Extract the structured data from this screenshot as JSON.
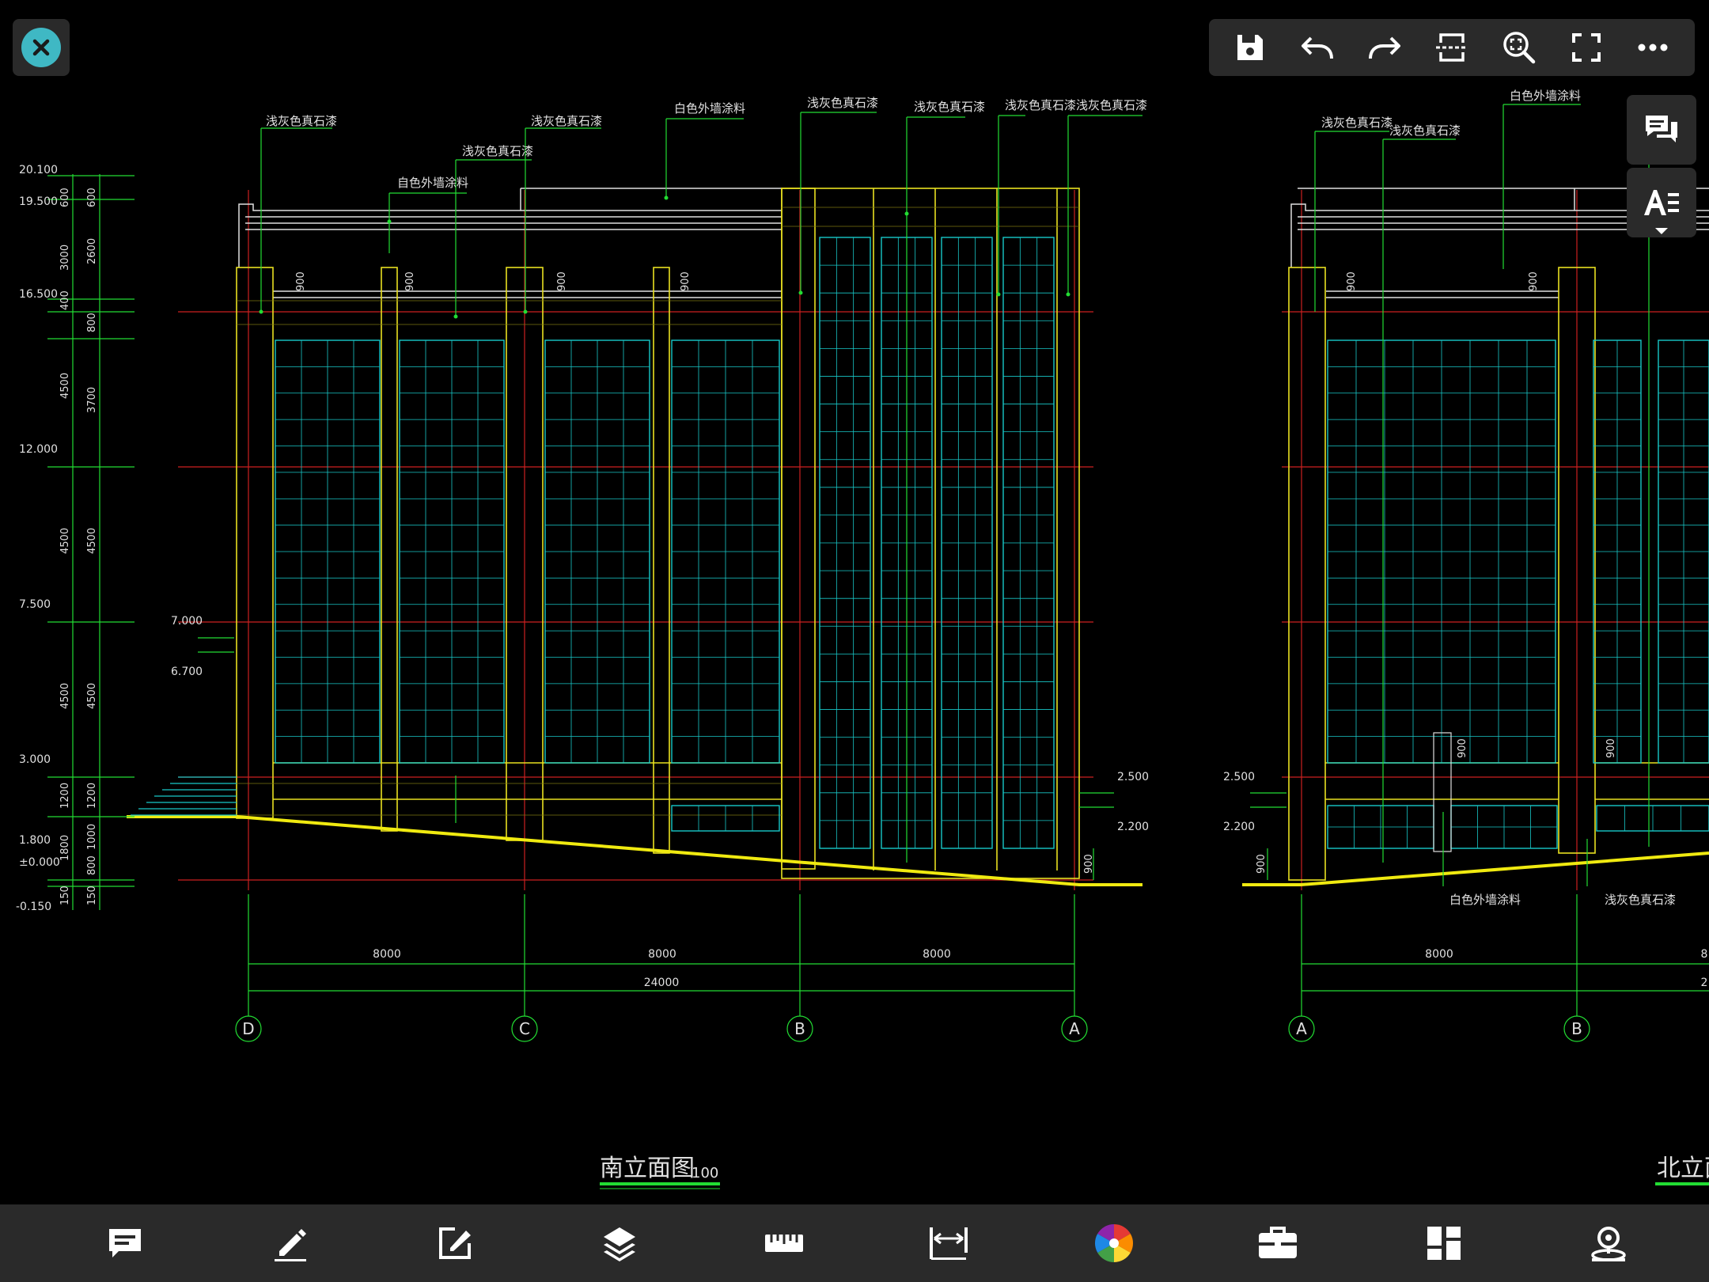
{
  "drawing": {
    "annotations_south": [
      "浅灰色真石漆",
      "浅灰色真石漆",
      "浅灰色真石漆",
      "自色外墙涂料",
      "白色外墙涂料",
      "浅灰色真石漆",
      "浅灰色真石漆",
      "浅灰色真石漆浅灰色真石漆"
    ],
    "annotations_north": [
      "浅灰色真石漆",
      "浅灰色真石漆",
      "白色外墙涂料",
      "白色外墙涂料",
      "浅灰色真石漆"
    ],
    "elevations": [
      "20.100",
      "19.500",
      "16.500",
      "12.000",
      "7.500",
      "3.000",
      "1.800",
      "±0.000",
      "-0.150"
    ],
    "dims_outer": [
      "600",
      "3000",
      "400",
      "4500",
      "4500",
      "4500",
      "1200",
      "1800",
      "150"
    ],
    "dims_inner": [
      "600",
      "2600",
      "800",
      "3700",
      "4500",
      "4500",
      "1200",
      "1000",
      "800",
      "150"
    ],
    "step_levels": [
      "7.000",
      "6.700"
    ],
    "right_levels": [
      "2.500",
      "2.200"
    ],
    "left_levels_north": [
      "2.500",
      "2.200"
    ],
    "dim_900": "900",
    "bay_dim": "8000",
    "total_dim": "24000",
    "south_axes": [
      "D",
      "C",
      "B",
      "A"
    ],
    "north_axes": [
      "A",
      "B"
    ],
    "north_total_partial": "2",
    "north_bay_partial": "8",
    "south_title": "南立面图",
    "south_scale": "100",
    "north_title": "北立面图"
  },
  "toolbar": {
    "icons": [
      "save-icon",
      "undo-icon",
      "redo-icon",
      "section-icon",
      "zoom-region-icon",
      "fullscreen-icon",
      "more-icon"
    ]
  },
  "side": {
    "icons": [
      "comments-icon",
      "text-style-icon"
    ]
  },
  "bottom": {
    "icons": [
      "annotation-icon",
      "pen-icon",
      "edit-icon",
      "layers-icon",
      "measure-icon",
      "dimension-icon",
      "color-wheel-icon",
      "toolbox-icon",
      "layout-icon",
      "3d-view-icon"
    ]
  },
  "colors": {
    "background": "#000000",
    "panel": "#2a2a2a",
    "accent": "#3fb8c4",
    "cad_green": "#22dd33",
    "cad_cyan": "#18c8c8",
    "cad_yellow": "#e8e020",
    "cad_red": "#cc2020",
    "cad_white": "#e0e0e0"
  }
}
